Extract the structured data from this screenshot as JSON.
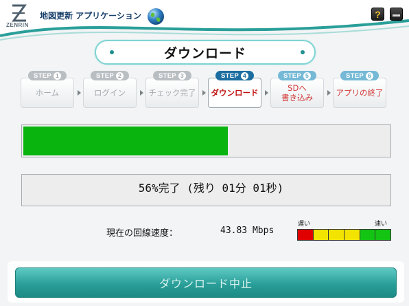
{
  "header": {
    "logo_text": "ZENRIN",
    "app_title": "地図更新 アプリケーション",
    "help_label": "?",
    "icons": {
      "logo": "zenrin-z-logo",
      "globe": "globe-icon",
      "help": "help-icon",
      "minimize": "minimize-icon"
    }
  },
  "banner": {
    "title": "ダウンロード"
  },
  "steps": [
    {
      "tag": "STEP",
      "num": "1",
      "label": "ホーム",
      "state": "done"
    },
    {
      "tag": "STEP",
      "num": "2",
      "label": "ログイン",
      "state": "done"
    },
    {
      "tag": "STEP",
      "num": "3",
      "label": "チェック完了",
      "state": "done"
    },
    {
      "tag": "STEP",
      "num": "4",
      "label": "ダウンロード",
      "state": "current"
    },
    {
      "tag": "STEP",
      "num": "5",
      "label": "SDへ\n書き込み",
      "state": "future"
    },
    {
      "tag": "STEP",
      "num": "6",
      "label": "アプリの終了",
      "state": "future"
    }
  ],
  "progress": {
    "percent": 56
  },
  "status": {
    "text": "56%完了 (残り 01分 01秒)"
  },
  "speed": {
    "label": "現在の回線速度：",
    "value": "43.83 Mbps",
    "slow_label": "遅い",
    "fast_label": "速い",
    "meter_colors": [
      "#e00000",
      "#f2e400",
      "#f2e400",
      "#f2e400",
      "#13c413",
      "#13c413"
    ]
  },
  "colors": {
    "progress_fill": "#09b40f",
    "accent": "#2a9f99",
    "current_step": "#c01515"
  },
  "actions": {
    "stop_label": "ダウンロード中止"
  }
}
